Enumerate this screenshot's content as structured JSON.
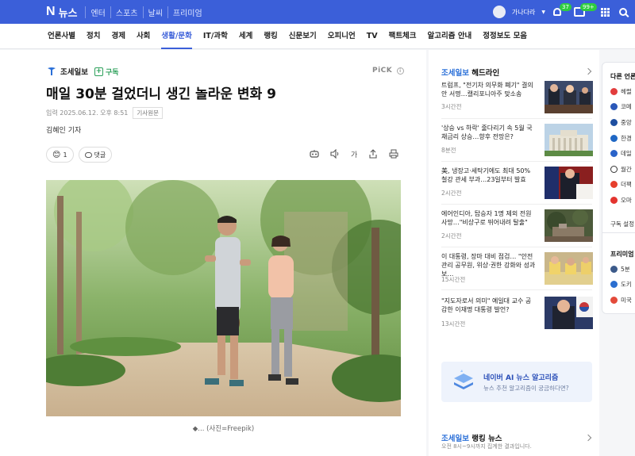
{
  "header": {
    "logo_n": "N",
    "logo_text": "뉴스",
    "nav": [
      "엔터",
      "스포츠",
      "날씨",
      "프리미엄"
    ],
    "user_name": "가나다라",
    "badge_mail": "37",
    "badge_noti": "99+"
  },
  "subnav": [
    "언론사별",
    "정치",
    "경제",
    "사회",
    "생활/문화",
    "IT/과학",
    "세계",
    "랭킹",
    "신문보기",
    "오피니언",
    "TV",
    "팩트체크",
    "알고리즘 안내",
    "정정보도 모음"
  ],
  "subnav_active_index": 4,
  "article": {
    "press": "조세일보",
    "subscribe": "구독",
    "pick": "PiCK",
    "title": "매일 30분 걸었더니 생긴 놀라운 변화 9",
    "date": "입력 2025.06.12. 오후 8:51",
    "original": "기사원문",
    "reporter": "김혜인 기자",
    "reaction_count": "1",
    "comment_label": "댓글",
    "caption": "◆... (사진=Freepik)"
  },
  "sidebar": {
    "headline_press": "조세일보",
    "headline_label": "헤드라인",
    "news": [
      {
        "title": "트럼프, \"전기차 의무화 폐기\" 결의안 서명…캘리포니아주 맞소송",
        "time": "3시간전"
      },
      {
        "title": "'상승 vs 하락' 줄다리기 속 5월 국채금리 상승…향후 전망은?",
        "time": "8분전"
      },
      {
        "title": "美, 냉장고·세탁기에도 최대 50% 철강 관세 부과…23일부터 발효",
        "time": "2시간전"
      },
      {
        "title": "에어인디아, 탑승자 1명 제외 전원 사망…\"비상구로 뛰어내려 탈출\"",
        "time": "2시간전"
      },
      {
        "title": "이 대통령, 장마 대비 점검… \"안전관리 공무원, 위상·권한 강화와 성과 보…",
        "time": "15시간전"
      },
      {
        "title": "\"지도자로서 의미\" 예일대 교수 공감한 이재명 대통령 발언?",
        "time": "13시간전"
      }
    ],
    "ai_title": "네이버 AI 뉴스 알고리즘",
    "ai_sub": "뉴스 추천 알고리즘이 궁금하다면?",
    "rank_press": "조세일보",
    "rank_label": "랭킹 뉴스",
    "rank_sub": "오전 8시~9시까지 집계한 결과입니다."
  },
  "sidebar2": {
    "title1": "다른 언론사",
    "items1": [
      "헤럴",
      "코메",
      "중앙",
      "한경",
      "데일",
      "월간",
      "더팩",
      "오마"
    ],
    "setting": "구독 설정",
    "title2": "프리미엄",
    "items2": [
      "5분",
      "도키",
      "미국"
    ]
  }
}
